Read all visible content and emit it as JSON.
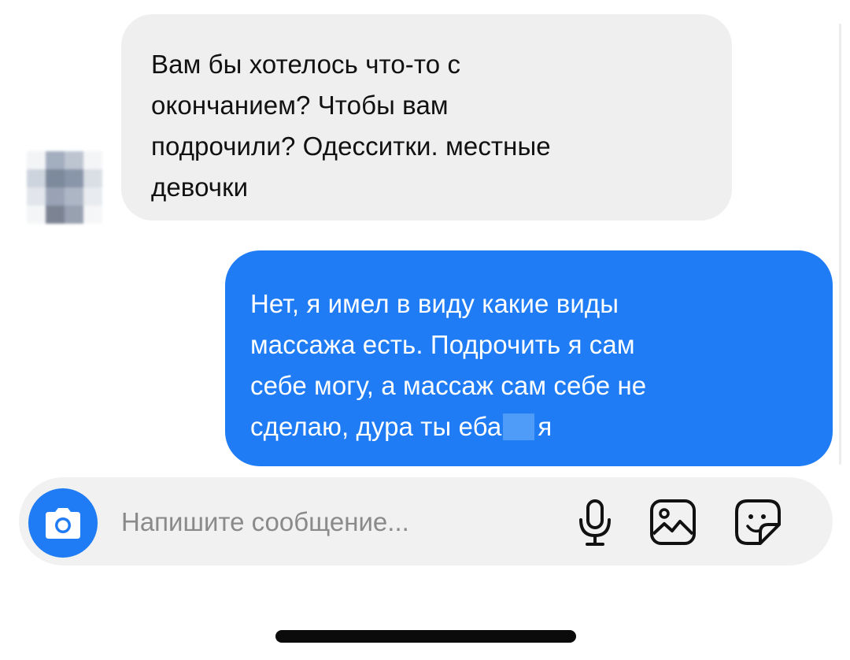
{
  "incoming_message": {
    "lines": [
      "Вам бы хотелось что-то с",
      "окончанием? Чтобы вам",
      "подрочили? Одесситки. местные",
      "девочки"
    ]
  },
  "outgoing_message": {
    "lines": [
      "Нет, я имел в виду какие виды",
      "массажа есть. Подрочить я сам",
      "себе могу, а массаж сам себе не"
    ],
    "last_line_start": "сделаю, дура ты еба",
    "last_line_end": "я"
  },
  "composer": {
    "placeholder": "Напишите сообщение..."
  },
  "icons": {
    "camera": "camera-icon",
    "mic": "microphone-icon",
    "gallery": "gallery-icon",
    "sticker": "sticker-icon"
  },
  "colors": {
    "outgoing_bubble": "#1f7cf5",
    "incoming_bubble": "#efefef",
    "camera_button": "#1f7cf5"
  }
}
